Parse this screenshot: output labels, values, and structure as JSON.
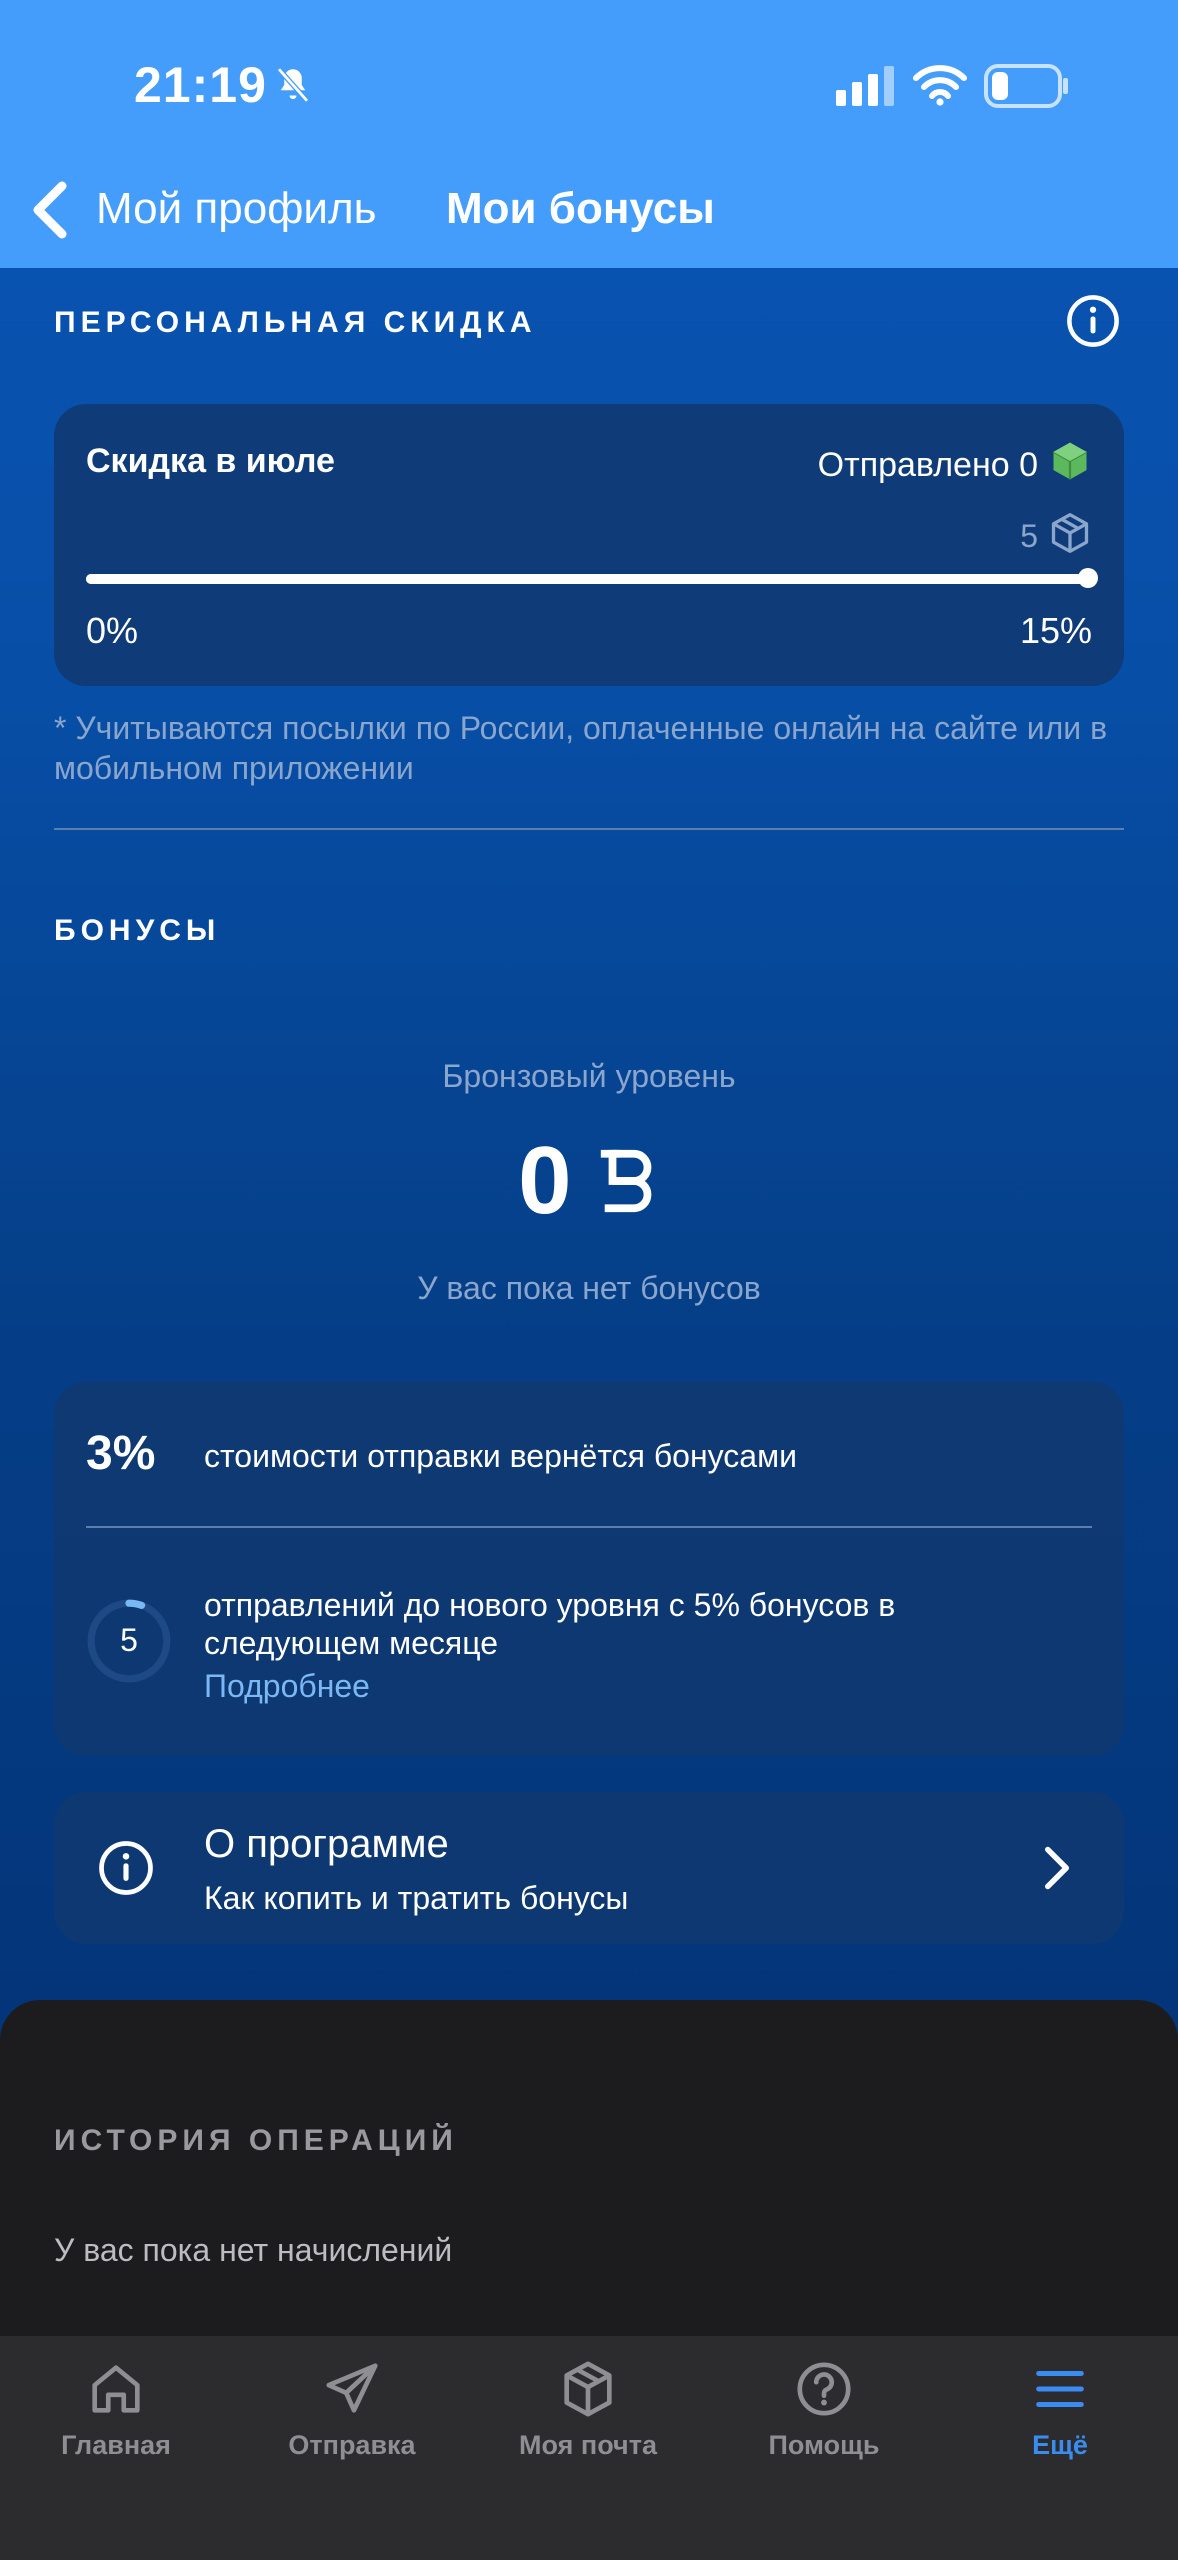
{
  "status_bar": {
    "time": "21:19"
  },
  "nav": {
    "back_label": "Мой профиль",
    "title": "Мои бонусы"
  },
  "discount": {
    "section_title": "ПЕРСОНАЛЬНАЯ СКИДКА",
    "card_title": "Скидка в июле",
    "sent_label": "Отправлено 0",
    "goal_count": "5",
    "min_label": "0%",
    "max_label": "15%",
    "progress": 1.0,
    "footnote": "* Учитываются посылки по России, оплаченные онлайн на сайте или в мобильном приложении"
  },
  "bonuses": {
    "section_title": "БОНУСЫ",
    "level": "Бронзовый уровень",
    "balance": "0",
    "empty_text": "У вас пока нет бонусов",
    "cashback_pct": "3%",
    "cashback_text": "стоимости отправки вернётся бонусами",
    "shipments_left": "5",
    "next_level_text": "отправлений до нового уровня с 5% бонусов в следующем месяце",
    "more_link": "Подробнее"
  },
  "program": {
    "title": "О программе",
    "subtitle": "Как копить и тратить бонусы"
  },
  "history": {
    "title": "ИСТОРИЯ ОПЕРАЦИЙ",
    "empty_text": "У вас пока нет начислений"
  },
  "tabbar": {
    "items": [
      {
        "label": "Главная",
        "icon": "home-icon"
      },
      {
        "label": "Отправка",
        "icon": "send-icon"
      },
      {
        "label": "Моя почта",
        "icon": "package-icon"
      },
      {
        "label": "Помощь",
        "icon": "help-icon"
      },
      {
        "label": "Ещё",
        "icon": "menu-icon"
      }
    ]
  },
  "colors": {
    "header_bg": "#459dfb",
    "accent_link": "#7ab8f5",
    "tab_active": "#3a8cf0",
    "box_green": "#5cb85c"
  }
}
